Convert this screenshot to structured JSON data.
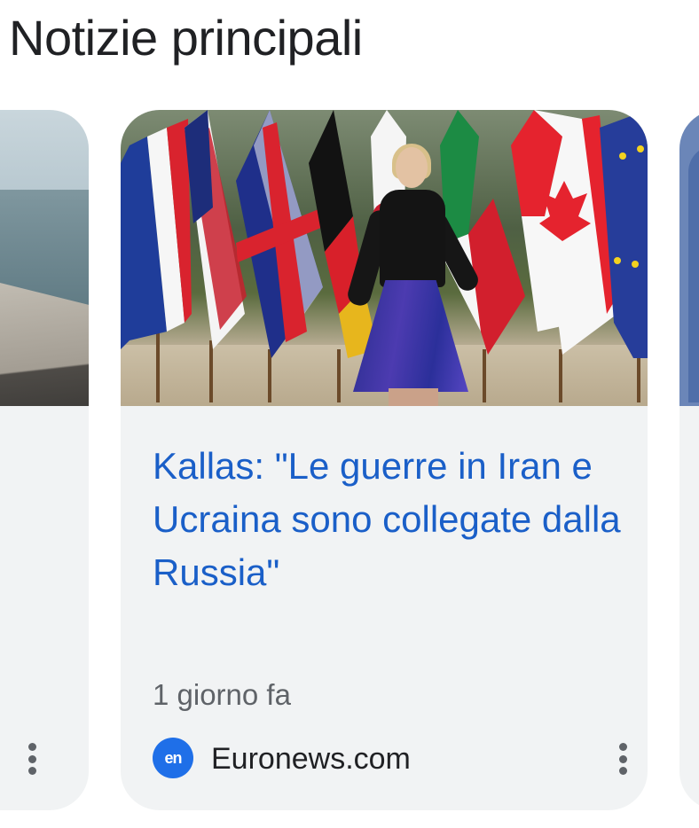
{
  "section": {
    "title": "Notizie principali"
  },
  "main_card": {
    "headline": "Kallas: \"Le guerre in Iran e Ucraina sono collegate dalla Russia\"",
    "time": "1 giorno fa",
    "source_logo_text": "en",
    "source_name": "Euronews.com",
    "more_icon": "more-vert-icon",
    "headline_color": "#1a5fc8"
  },
  "left_card": {
    "more_icon": "more-vert-icon"
  },
  "colors": {
    "card_background": "#f1f3f4",
    "source_logo": "#1f6fe8"
  }
}
